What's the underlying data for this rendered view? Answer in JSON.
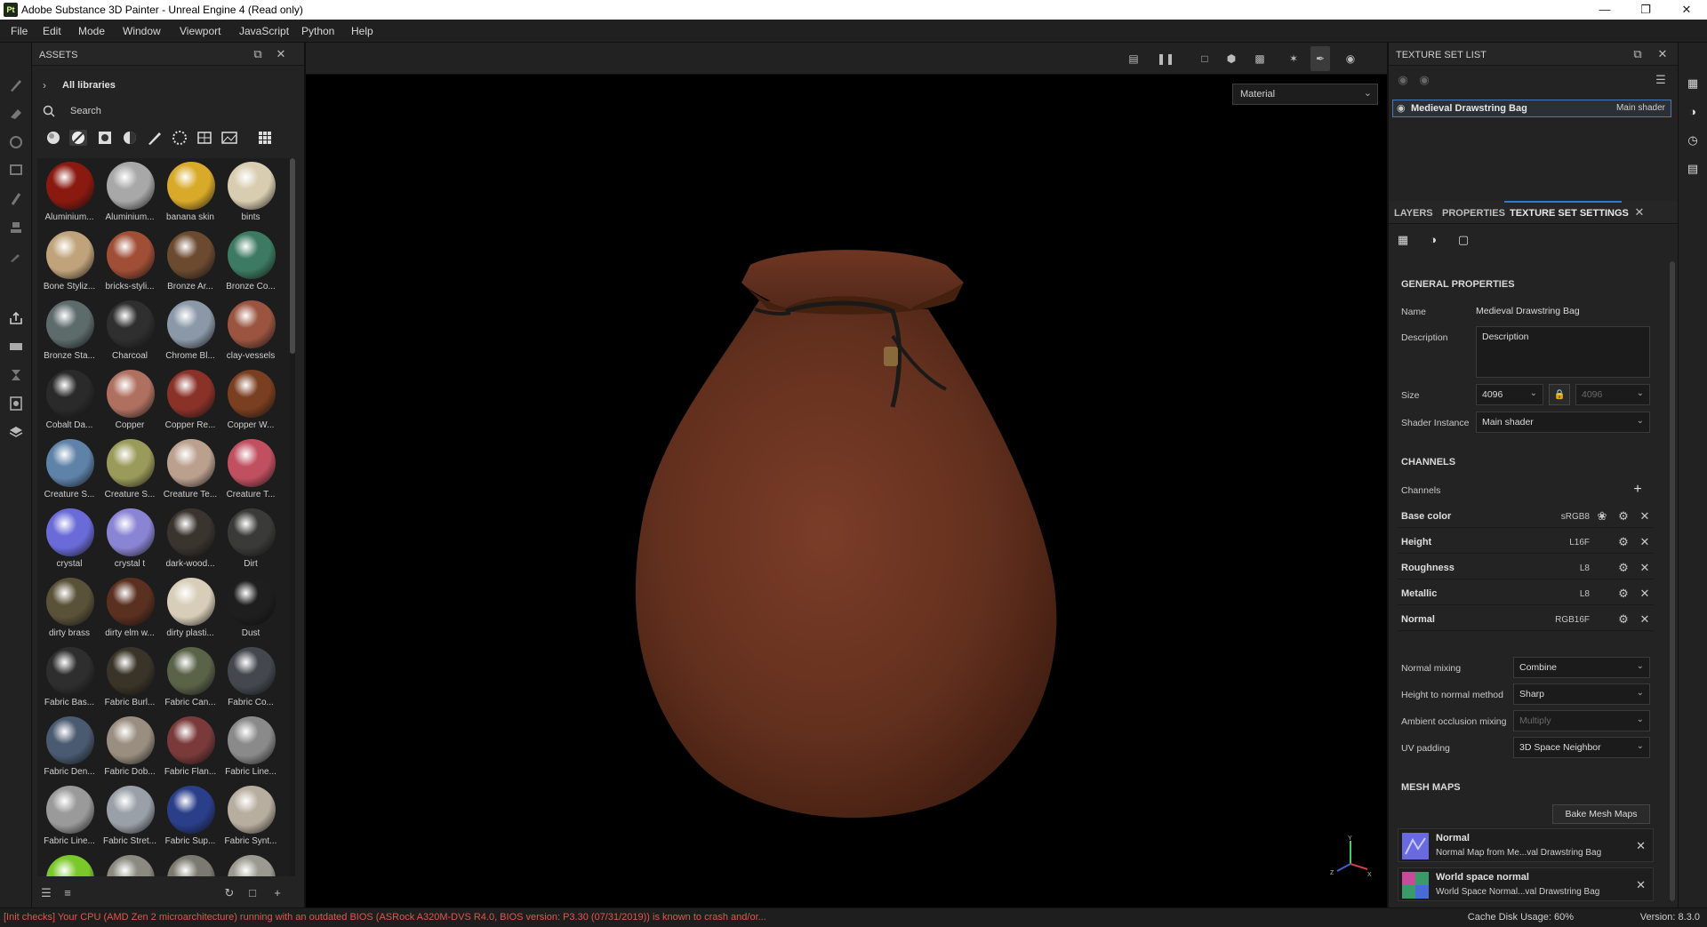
{
  "window": {
    "app_icon": "Pt",
    "title": "Adobe Substance 3D Painter - Unreal Engine 4 (Read only)",
    "controls": [
      "minimize-icon",
      "restore-icon",
      "close-icon"
    ]
  },
  "menu": [
    "File",
    "Edit",
    "Mode",
    "Window",
    "Viewport",
    "JavaScript",
    "Python",
    "Help"
  ],
  "assets": {
    "title": "ASSETS",
    "library": "All libraries",
    "search_placeholder": "Search",
    "items": [
      {
        "label": "Aluminium...",
        "color": "#8a1a10"
      },
      {
        "label": "Aluminium...",
        "color": "#a8a8a8"
      },
      {
        "label": "banana skin",
        "color": "#d9a92a"
      },
      {
        "label": "bints",
        "color": "#d8cdb0"
      },
      {
        "label": "Bone Styliz...",
        "color": "#c0a37a"
      },
      {
        "label": "bricks-styli...",
        "color": "#a04e36"
      },
      {
        "label": "Bronze Ar...",
        "color": "#6b4a30"
      },
      {
        "label": "Bronze Co...",
        "color": "#3d7a63"
      },
      {
        "label": "Bronze Sta...",
        "color": "#5d6b6a"
      },
      {
        "label": "Charcoal",
        "color": "#2f2f2f"
      },
      {
        "label": "Chrome Bl...",
        "color": "#8a98a8"
      },
      {
        "label": "clay-vessels",
        "color": "#9a5440"
      },
      {
        "label": "Cobalt Da...",
        "color": "#2a2a2a"
      },
      {
        "label": "Copper",
        "color": "#b07060"
      },
      {
        "label": "Copper Re...",
        "color": "#8a3228"
      },
      {
        "label": "Copper W...",
        "color": "#7a3e20"
      },
      {
        "label": "Creature S...",
        "color": "#5e82a8"
      },
      {
        "label": "Creature S...",
        "color": "#9a9a5a"
      },
      {
        "label": "Creature Te...",
        "color": "#bba08e"
      },
      {
        "label": "Creature T...",
        "color": "#c05060"
      },
      {
        "label": "crystal",
        "color": "#6a6ad8"
      },
      {
        "label": "crystal t",
        "color": "#8a84d4"
      },
      {
        "label": "dark-wood...",
        "color": "#3a342e"
      },
      {
        "label": "Dirt",
        "color": "#3a3a38"
      },
      {
        "label": "dirty brass",
        "color": "#5a5238"
      },
      {
        "label": "dirty elm w...",
        "color": "#5a3020"
      },
      {
        "label": "dirty plasti...",
        "color": "#d8cdb8"
      },
      {
        "label": "Dust",
        "color": "#1e1e1e"
      },
      {
        "label": "Fabric Bas...",
        "color": "#2e2e2e"
      },
      {
        "label": "Fabric Burl...",
        "color": "#3a3428"
      },
      {
        "label": "Fabric Can...",
        "color": "#5a6248"
      },
      {
        "label": "Fabric Co...",
        "color": "#44484e"
      },
      {
        "label": "Fabric Den...",
        "color": "#4a5a70"
      },
      {
        "label": "Fabric Dob...",
        "color": "#9a8e80"
      },
      {
        "label": "Fabric Flan...",
        "color": "#7a3a3a"
      },
      {
        "label": "Fabric Line...",
        "color": "#8a8a8a"
      },
      {
        "label": "Fabric Line...",
        "color": "#9a9a9a"
      },
      {
        "label": "Fabric Stret...",
        "color": "#9aa0a8"
      },
      {
        "label": "Fabric Sup...",
        "color": "#2a3e8a"
      },
      {
        "label": "Fabric Synt...",
        "color": "#b8aea0"
      },
      {
        "label": "",
        "color": "#7ac82a"
      },
      {
        "label": "",
        "color": "#8a8a80"
      },
      {
        "label": "",
        "color": "#7a7a70"
      },
      {
        "label": "",
        "color": "#9a9a90"
      }
    ]
  },
  "viewport": {
    "mode_select": "Material",
    "axis": {
      "y": "Y",
      "z": "Z",
      "x": "X"
    }
  },
  "texture_set_list": {
    "title": "TEXTURE SET LIST",
    "row": {
      "name": "Medieval Drawstring Bag",
      "shader": "Main shader"
    }
  },
  "settings": {
    "tabs": [
      "LAYERS",
      "PROPERTIES",
      "TEXTURE SET SETTINGS"
    ],
    "general_title": "GENERAL PROPERTIES",
    "name_label": "Name",
    "name_value": "Medieval Drawstring Bag",
    "description_label": "Description",
    "description_value": "Description",
    "size_label": "Size",
    "size_value": "4096",
    "size_value_linked": "4096",
    "shader_label": "Shader Instance",
    "shader_value": "Main shader",
    "channels_title": "CHANNELS",
    "channels_label": "Channels",
    "channels": [
      {
        "name": "Base color",
        "format": "sRGB8"
      },
      {
        "name": "Height",
        "format": "L16F"
      },
      {
        "name": "Roughness",
        "format": "L8"
      },
      {
        "name": "Metallic",
        "format": "L8"
      },
      {
        "name": "Normal",
        "format": "RGB16F"
      }
    ],
    "normal_mixing_label": "Normal mixing",
    "normal_mixing_value": "Combine",
    "h2n_label": "Height to normal method",
    "h2n_value": "Sharp",
    "ao_label": "Ambient occlusion mixing",
    "ao_value": "Multiply",
    "uv_label": "UV padding",
    "uv_value": "3D Space Neighbor",
    "mesh_maps_title": "MESH MAPS",
    "bake_button": "Bake Mesh Maps",
    "mesh_maps": [
      {
        "title": "Normal",
        "sub": "Normal Map from Me...val Drawstring Bag"
      },
      {
        "title": "World space normal",
        "sub": "World Space Normal...val Drawstring Bag"
      }
    ]
  },
  "status": {
    "message": "[Init checks] Your CPU (AMD Zen 2 microarchitecture) running with an outdated BIOS (ASRock A320M-DVS R4.0, BIOS version: P3.30 (07/31/2019)) is known to crash and/or...",
    "cache": "Cache Disk Usage:   60%",
    "version": "Version: 8.3.0"
  }
}
